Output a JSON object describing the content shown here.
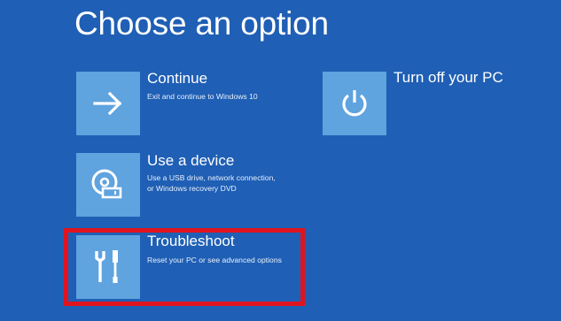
{
  "page": {
    "title": "Choose an option"
  },
  "options": [
    {
      "id": "continue",
      "title": "Continue",
      "description_lines": [
        "Exit and continue to Windows 10"
      ],
      "icon": "arrow-right-icon"
    },
    {
      "id": "use-device",
      "title": "Use a device",
      "description_lines": [
        "Use a USB drive, network connection,",
        "or Windows recovery DVD"
      ],
      "icon": "disc-drive-icon"
    },
    {
      "id": "troubleshoot",
      "title": "Troubleshoot",
      "description_lines": [
        "Reset your PC or see advanced options"
      ],
      "icon": "tools-icon",
      "highlighted": true
    },
    {
      "id": "turn-off",
      "title": "Turn off your PC",
      "description_lines": [],
      "icon": "power-icon"
    }
  ],
  "colors": {
    "background": "#1f5fb5",
    "tile": "#5fa3df",
    "highlight": "#e0141e",
    "text": "#ffffff"
  }
}
